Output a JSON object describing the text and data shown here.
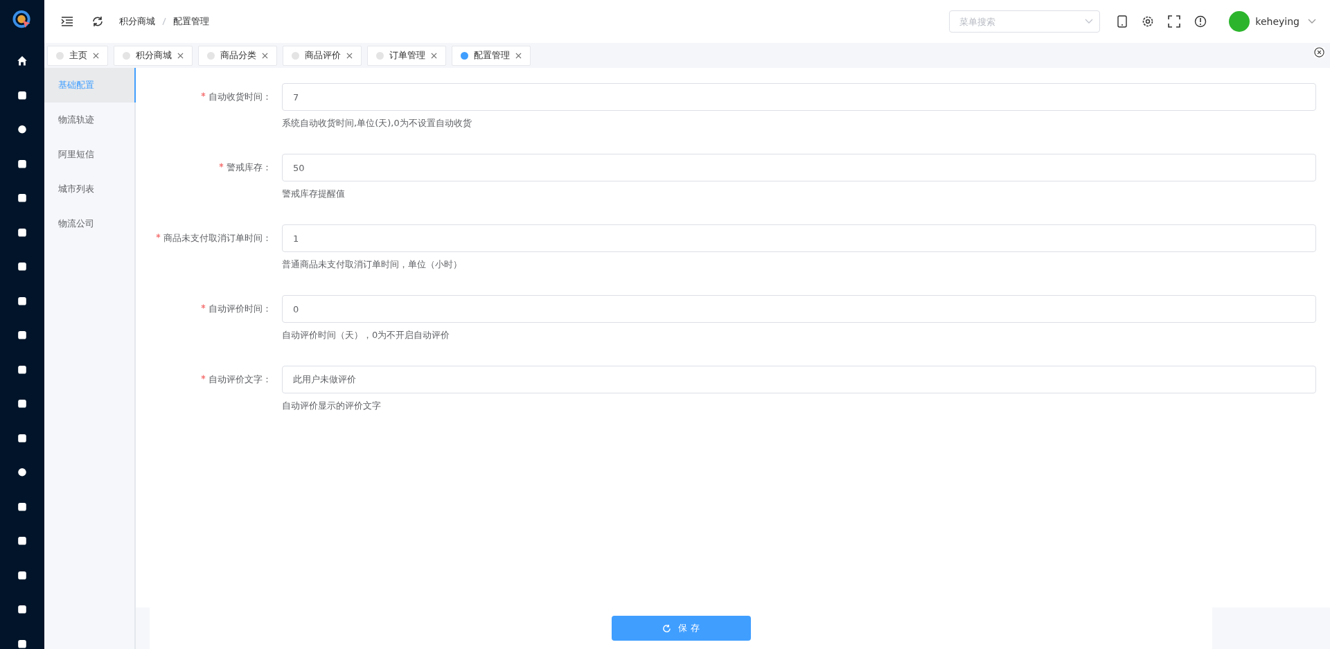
{
  "breadcrumb": [
    "积分商城",
    "配置管理"
  ],
  "search": {
    "placeholder": "菜单搜索"
  },
  "user": {
    "name": "keheying"
  },
  "tabs": [
    {
      "label": "主页",
      "selected": false
    },
    {
      "label": "积分商城",
      "selected": false
    },
    {
      "label": "商品分类",
      "selected": false
    },
    {
      "label": "商品评价",
      "selected": false
    },
    {
      "label": "订单管理",
      "selected": false
    },
    {
      "label": "配置管理",
      "selected": true
    }
  ],
  "submenu": [
    {
      "label": "基础配置",
      "selected": true
    },
    {
      "label": "物流轨迹",
      "selected": false
    },
    {
      "label": "阿里短信",
      "selected": false
    },
    {
      "label": "城市列表",
      "selected": false
    },
    {
      "label": "物流公司",
      "selected": false
    }
  ],
  "form": [
    {
      "label": "自动收货时间：",
      "required": true,
      "value": "7",
      "hint": "系统自动收货时间,单位(天),0为不设置自动收货"
    },
    {
      "label": "警戒库存：",
      "required": true,
      "value": "50",
      "hint": "警戒库存提醒值"
    },
    {
      "label": "商品未支付取消订单时间：",
      "required": true,
      "value": "1",
      "hint": "普通商品未支付取消订单时间，单位（小时）"
    },
    {
      "label": "自动评价时间：",
      "required": true,
      "value": "0",
      "hint": "自动评价时间（天），0为不开启自动评价"
    },
    {
      "label": "自动评价文字：",
      "required": true,
      "value": "此用户未做评价",
      "hint": "自动评价显示的评价文字"
    }
  ],
  "save_button": "保 存"
}
